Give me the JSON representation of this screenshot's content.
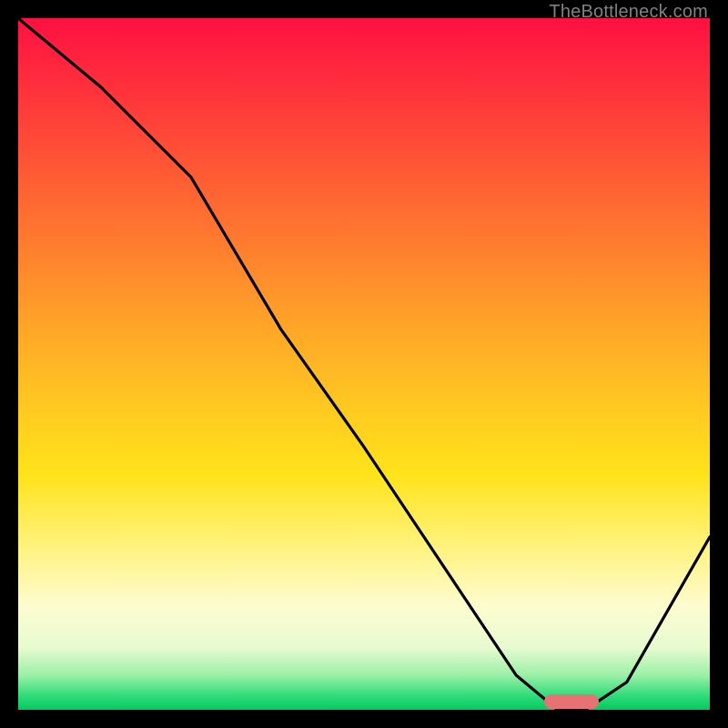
{
  "watermark": "TheBottleneck.com",
  "chart_data": {
    "type": "line",
    "title": "",
    "xlabel": "",
    "ylabel": "",
    "xlim": [
      0,
      100
    ],
    "ylim": [
      0,
      100
    ],
    "grid": false,
    "legend": false,
    "series": [
      {
        "name": "bottleneck-curve",
        "x": [
          0,
          12,
          25,
          38,
          50,
          62,
          72,
          78,
          82,
          88,
          100
        ],
        "values": [
          100,
          90,
          77,
          55,
          38,
          20,
          5,
          0,
          0,
          4,
          25
        ]
      }
    ],
    "marker": {
      "name": "optimal-range",
      "x_start": 76,
      "x_end": 84,
      "y": 1.2,
      "color": "#e57373"
    },
    "background_gradient": {
      "stops": [
        {
          "pos": 0,
          "color": "#ff1041"
        },
        {
          "pos": 20,
          "color": "#ff5236"
        },
        {
          "pos": 44,
          "color": "#ffa328"
        },
        {
          "pos": 66,
          "color": "#ffe31a"
        },
        {
          "pos": 85,
          "color": "#fdfccf"
        },
        {
          "pos": 95,
          "color": "#9bf0a6"
        },
        {
          "pos": 100,
          "color": "#04c95f"
        }
      ]
    }
  }
}
